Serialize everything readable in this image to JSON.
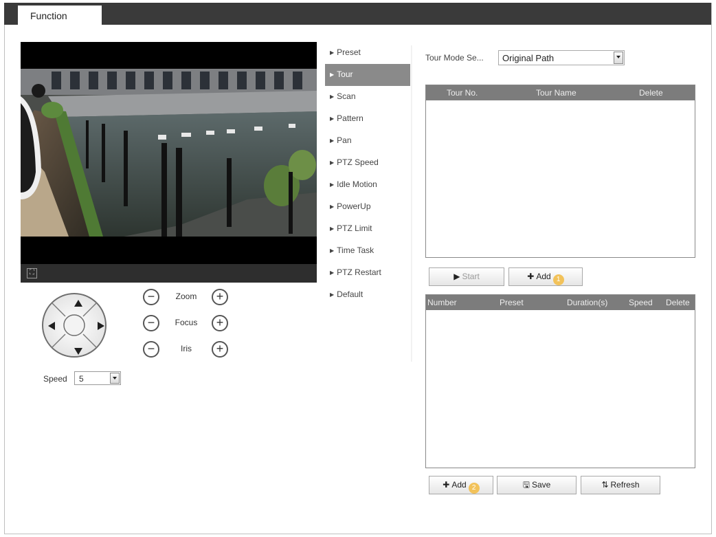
{
  "tabs": {
    "function_label": "Function"
  },
  "controls": {
    "zoom_label": "Zoom",
    "focus_label": "Focus",
    "iris_label": "Iris",
    "minus_symbol": "−",
    "plus_symbol": "+",
    "speed_label": "Speed",
    "speed_value": "5"
  },
  "menu": {
    "items": [
      {
        "label": "Preset",
        "active": false
      },
      {
        "label": "Tour",
        "active": true
      },
      {
        "label": "Scan",
        "active": false
      },
      {
        "label": "Pattern",
        "active": false
      },
      {
        "label": "Pan",
        "active": false
      },
      {
        "label": "PTZ Speed",
        "active": false
      },
      {
        "label": "Idle Motion",
        "active": false
      },
      {
        "label": "PowerUp",
        "active": false
      },
      {
        "label": "PTZ Limit",
        "active": false
      },
      {
        "label": "Time Task",
        "active": false
      },
      {
        "label": "PTZ Restart",
        "active": false
      },
      {
        "label": "Default",
        "active": false
      }
    ]
  },
  "tour": {
    "mode_label": "Tour Mode Se...",
    "mode_value": "Original Path",
    "tour_table": {
      "headers": [
        "Tour No.",
        "Tour Name",
        "Delete"
      ],
      "rows": []
    },
    "start_label": "Start",
    "add_label": "Add",
    "add_badge": "1",
    "preset_table": {
      "headers": [
        "Number",
        "Preset",
        "Duration(s)",
        "Speed",
        "Delete"
      ],
      "rows": []
    },
    "add2_label": "Add",
    "add2_badge": "2",
    "save_label": "Save",
    "refresh_label": "Refresh"
  },
  "colors": {
    "tab_bar": "#3a3a3a",
    "active_menu": "#8a8a8a",
    "table_header": "#7c7c7c",
    "badge": "#f2c25a"
  }
}
